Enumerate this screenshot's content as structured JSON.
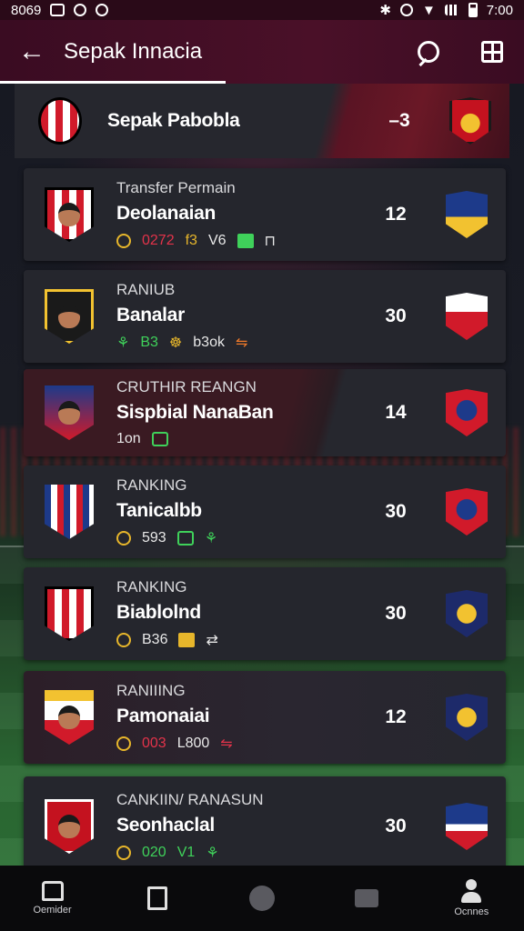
{
  "status_bar": {
    "time_left": "8069",
    "time_right": "7:00"
  },
  "app_bar": {
    "title": "Sepak Innacia",
    "back_icon": "arrow-left-icon",
    "actions": [
      "search-icon",
      "grid-icon"
    ]
  },
  "header_match": {
    "name": "Sepak Pabobla",
    "score": "–3"
  },
  "cards": [
    {
      "category": "Transfer Permain",
      "name": "Deolanaian",
      "score": "12",
      "meta": [
        {
          "icon": "coin-icon",
          "text": ""
        },
        {
          "text": "0272",
          "color": "red"
        },
        {
          "text": "f3",
          "color": "yellow"
        },
        {
          "text": "V6",
          "color": "white"
        },
        {
          "icon": "flag-icon"
        },
        {
          "text": "⊓",
          "color": "white"
        }
      ]
    },
    {
      "category": "RANIUB",
      "name": "Banalar",
      "score": "30",
      "meta": [
        {
          "text": "⚘",
          "color": "green"
        },
        {
          "text": "B3",
          "color": "green"
        },
        {
          "text": "☸",
          "color": "yellow"
        },
        {
          "text": "b3ok",
          "color": "white"
        },
        {
          "text": "⇋",
          "color": "orange"
        }
      ]
    },
    {
      "category": "CRUTHIR REANGN",
      "name": "Sispbial NanaBan",
      "score": "14",
      "meta": [
        {
          "text": "1on",
          "color": "white"
        },
        {
          "icon": "lock-icon"
        }
      ]
    },
    {
      "category": "RANKING",
      "name": "Tanicalbb",
      "score": "30",
      "meta": [
        {
          "icon": "coin-icon",
          "text": ""
        },
        {
          "text": "593",
          "color": "white"
        },
        {
          "icon": "box-icon"
        },
        {
          "text": "⚘",
          "color": "green"
        }
      ]
    },
    {
      "category": "RANKING",
      "name": "Biablolnd",
      "score": "30",
      "meta": [
        {
          "icon": "coin-icon",
          "text": ""
        },
        {
          "text": "B36",
          "color": "white"
        },
        {
          "icon": "box-yellow-icon"
        },
        {
          "text": "⇄",
          "color": "white"
        }
      ]
    },
    {
      "category": "RANIIING",
      "name": "Pamonaiai",
      "score": "12",
      "meta": [
        {
          "icon": "coin-icon",
          "text": ""
        },
        {
          "text": "003",
          "color": "red"
        },
        {
          "text": "L800",
          "color": "white"
        },
        {
          "text": "⇋",
          "color": "red"
        }
      ]
    },
    {
      "category": "CANKIIN/ RANASUN",
      "name": "Seonhaclal",
      "score": "30",
      "meta": [
        {
          "icon": "coin-icon",
          "text": ""
        },
        {
          "text": "020",
          "color": "green"
        },
        {
          "text": "V1",
          "color": "green"
        },
        {
          "text": "⚘",
          "color": "green"
        }
      ]
    }
  ],
  "bottom_nav": [
    {
      "icon": "home-icon",
      "label": "Oemider"
    },
    {
      "icon": "document-icon",
      "label": ""
    },
    {
      "icon": "circle-icon",
      "label": ""
    },
    {
      "icon": "folder-icon",
      "label": ""
    },
    {
      "icon": "user-icon",
      "label": "Ocnnes"
    }
  ]
}
